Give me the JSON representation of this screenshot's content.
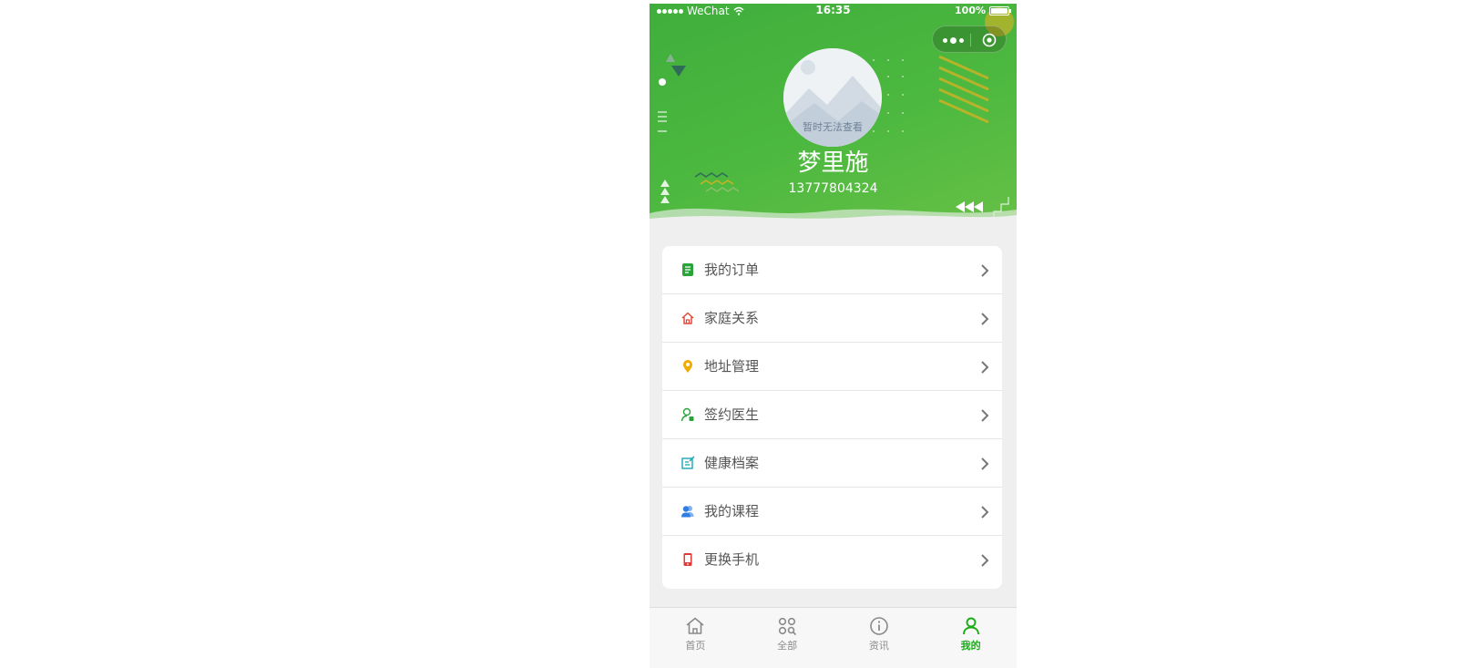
{
  "status_bar": {
    "carrier": "WeChat",
    "time": "16:35",
    "battery": "100%"
  },
  "capsule": {
    "more_icon": "more-dots-icon",
    "close_icon": "target-circle-icon"
  },
  "profile": {
    "avatar_caption": "暂时无法查看",
    "name": "梦里施",
    "phone": "13777804324"
  },
  "colors": {
    "brand_green": "#1aad19",
    "header_green": "#4cb83f",
    "orders_icon": "#2aa43a",
    "family_icon": "#e04a3a",
    "address_icon": "#f2a900",
    "doctor_icon": "#2aa43a",
    "health_icon": "#19a7b6",
    "course_icon": "#2f7de1",
    "phone_icon": "#e03a3a"
  },
  "menu": {
    "items": [
      {
        "label": "我的订单",
        "icon": "order-list-icon"
      },
      {
        "label": "家庭关系",
        "icon": "house-icon"
      },
      {
        "label": "地址管理",
        "icon": "location-pin-icon"
      },
      {
        "label": "签约医生",
        "icon": "doctor-icon"
      },
      {
        "label": "健康档案",
        "icon": "health-record-icon"
      },
      {
        "label": "我的课程",
        "icon": "users-icon"
      },
      {
        "label": "更换手机",
        "icon": "mobile-phone-icon"
      }
    ]
  },
  "tabbar": {
    "active": "我的",
    "tabs": [
      {
        "label": "首页",
        "icon": "home-icon"
      },
      {
        "label": "全部",
        "icon": "grid-search-icon"
      },
      {
        "label": "资讯",
        "icon": "info-icon"
      },
      {
        "label": "我的",
        "icon": "person-icon"
      }
    ]
  }
}
